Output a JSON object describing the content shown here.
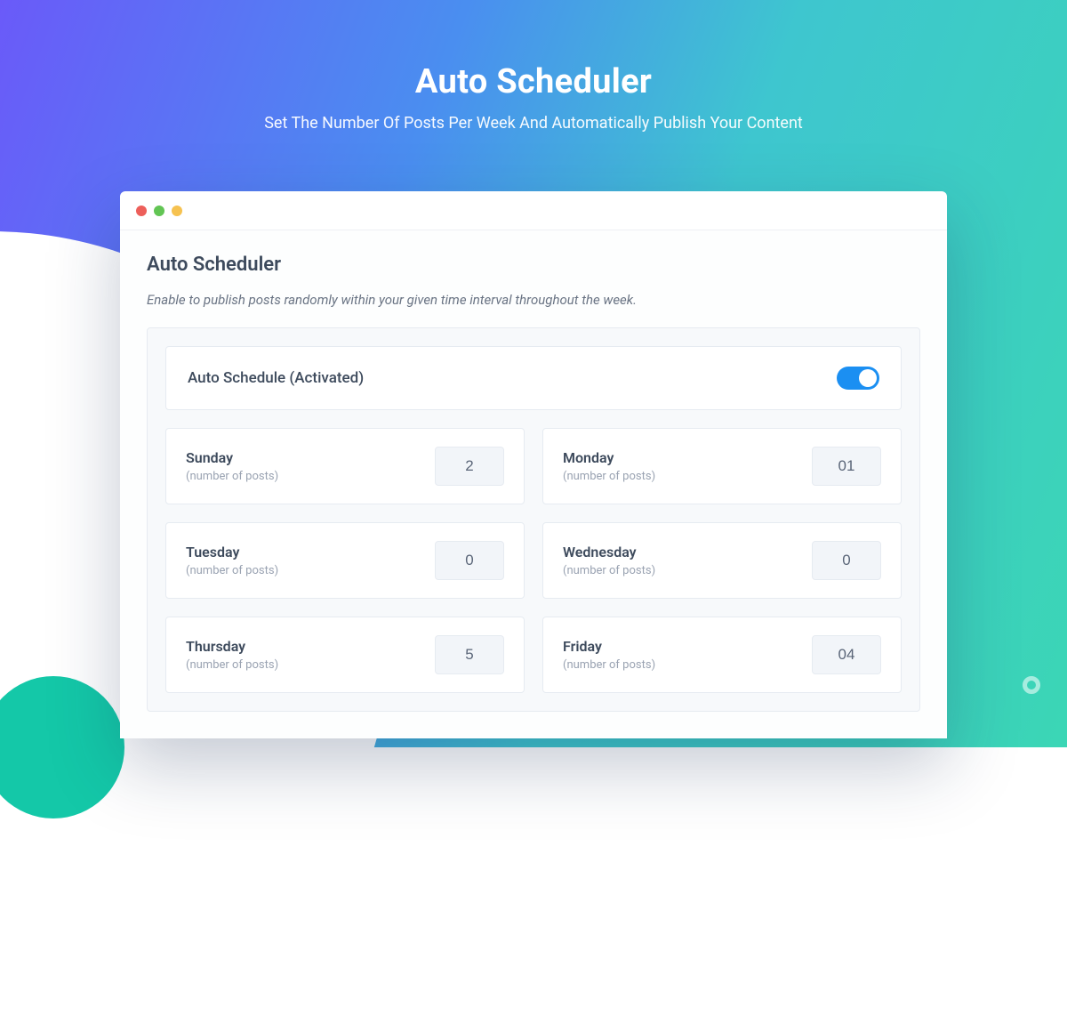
{
  "hero": {
    "title": "Auto Scheduler",
    "subtitle": "Set The Number Of Posts Per Week And Automatically Publish Your Content"
  },
  "panel": {
    "title": "Auto Scheduler",
    "description": "Enable to publish posts randomly within your given time interval throughout the week.",
    "toggle_label": "Auto Schedule (Activated)",
    "toggle_on": true,
    "posts_sublabel": "(number of posts)"
  },
  "days": [
    {
      "name": "Sunday",
      "value": "2"
    },
    {
      "name": "Monday",
      "value": "01"
    },
    {
      "name": "Tuesday",
      "value": "0"
    },
    {
      "name": "Wednesday",
      "value": "0"
    },
    {
      "name": "Thursday",
      "value": "5"
    },
    {
      "name": "Friday",
      "value": "04"
    }
  ]
}
